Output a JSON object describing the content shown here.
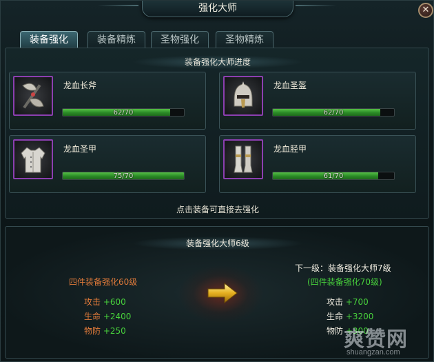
{
  "window": {
    "title": "强化大师",
    "close_label": "✕"
  },
  "tabs": [
    {
      "label": "装备强化",
      "active": true
    },
    {
      "label": "装备精炼",
      "active": false
    },
    {
      "label": "圣物强化",
      "active": false
    },
    {
      "label": "圣物精炼",
      "active": false
    }
  ],
  "progress_section": {
    "heading": "装备强化大师进度",
    "hint": "点击装备可直接去强化",
    "items": [
      {
        "name": "龙血长斧",
        "progress_text": "62/70",
        "current": 62,
        "max": 70,
        "icon": "axe-icon"
      },
      {
        "name": "龙血圣盔",
        "progress_text": "62/70",
        "current": 62,
        "max": 70,
        "icon": "helmet-icon"
      },
      {
        "name": "龙血圣甲",
        "progress_text": "75/70",
        "current": 75,
        "max": 70,
        "icon": "armor-icon"
      },
      {
        "name": "龙血胫甲",
        "progress_text": "61/70",
        "current": 61,
        "max": 70,
        "icon": "greaves-icon"
      }
    ]
  },
  "master_section": {
    "heading": "装备强化大师6级",
    "current": {
      "condition_prefix": "四件装备强化",
      "condition_level": "60",
      "condition_suffix": "级",
      "stats": [
        {
          "label": "攻击",
          "value": "+600"
        },
        {
          "label": "生命",
          "value": "+2400"
        },
        {
          "label": "物防",
          "value": "+250"
        }
      ]
    },
    "next": {
      "title": "下一级：装备强化大师7级",
      "condition": "(四件装备强化70级)",
      "stats": [
        {
          "label": "攻击",
          "value": "+700"
        },
        {
          "label": "生命",
          "value": "+3200"
        },
        {
          "label": "物防",
          "value": "+300"
        }
      ]
    }
  },
  "watermark": {
    "main": "爽赞网",
    "sub": "shuangzan.com"
  },
  "colors": {
    "accent_green": "#48d23c",
    "accent_orange": "#e07a3a",
    "rarity_purple": "#8c3fb0"
  }
}
